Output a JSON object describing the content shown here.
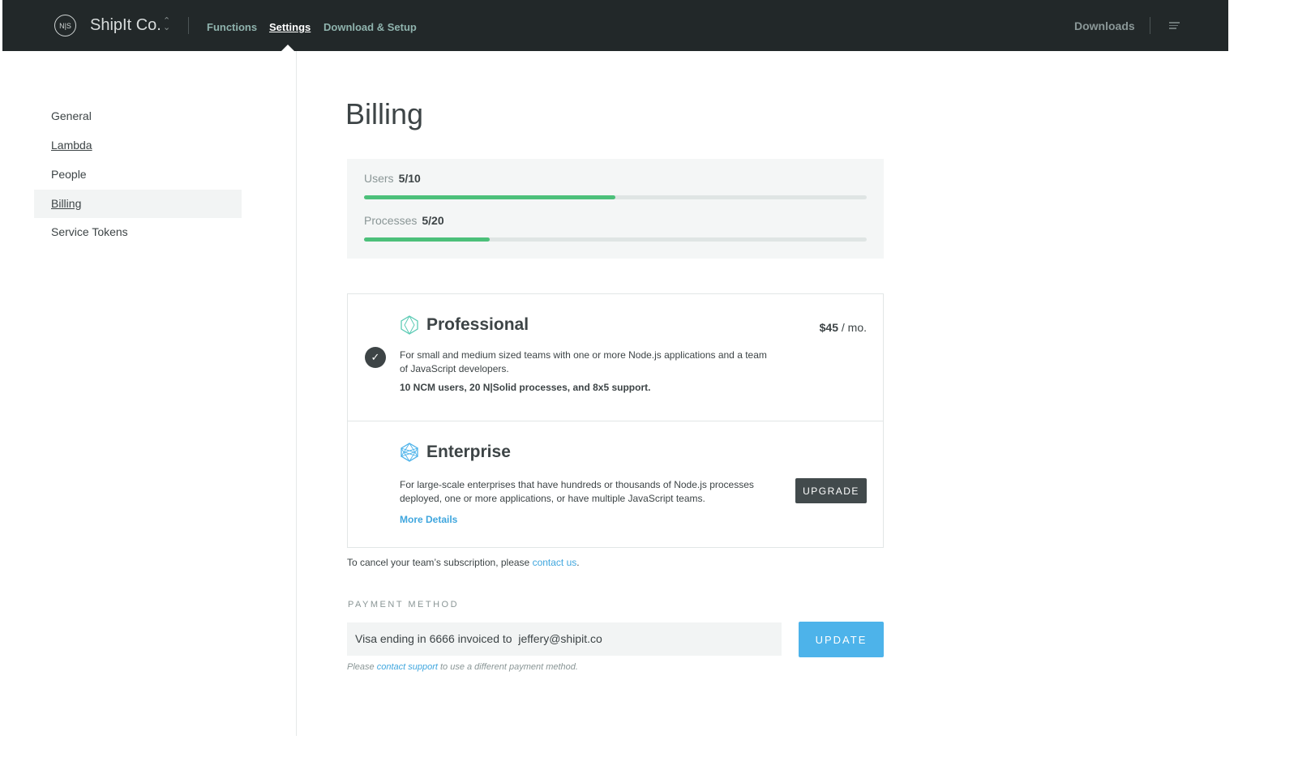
{
  "header": {
    "logo": "N|S",
    "org": "ShipIt Co.",
    "nav": [
      {
        "label": "Functions",
        "active": false
      },
      {
        "label": "Settings",
        "active": true
      },
      {
        "label": "Download & Setup",
        "active": false
      }
    ],
    "downloads": "Downloads"
  },
  "sidebar": {
    "items": [
      {
        "label": "General"
      },
      {
        "label": "Lambda"
      },
      {
        "label": "People"
      },
      {
        "label": "Billing",
        "active": true
      },
      {
        "label": "Service Tokens"
      }
    ]
  },
  "page": {
    "title": "Billing"
  },
  "usage": {
    "users": {
      "label": "Users",
      "value": "5/10",
      "percent": 50
    },
    "processes": {
      "label": "Processes",
      "value": "5/20",
      "percent": 25
    },
    "color": "#4cc07a"
  },
  "plans": {
    "professional": {
      "title": "Professional",
      "price": "$45",
      "per": " / mo.",
      "desc": "For small and medium sized teams with one or more Node.js applications and a team of JavaScript developers.",
      "features": "10 NCM users, 20 N|Solid processes, and 8x5 support.",
      "selected": true
    },
    "enterprise": {
      "title": "Enterprise",
      "desc": "For large-scale enterprises that have hundreds or thousands of Node.js processes deployed, one or more applications, or have multiple JavaScript teams.",
      "more": "More Details",
      "button": "UPGRADE"
    }
  },
  "cancel": {
    "text": "To cancel your team’s subscription, please ",
    "link": "contact us",
    "end": "."
  },
  "payment": {
    "label": "PAYMENT METHOD",
    "value": "Visa ending in 6666 invoiced to  jeffery@shipit.co",
    "button": "UPDATE",
    "note_pre": "Please ",
    "note_link": "contact support",
    "note_post": " to use a different payment method."
  }
}
